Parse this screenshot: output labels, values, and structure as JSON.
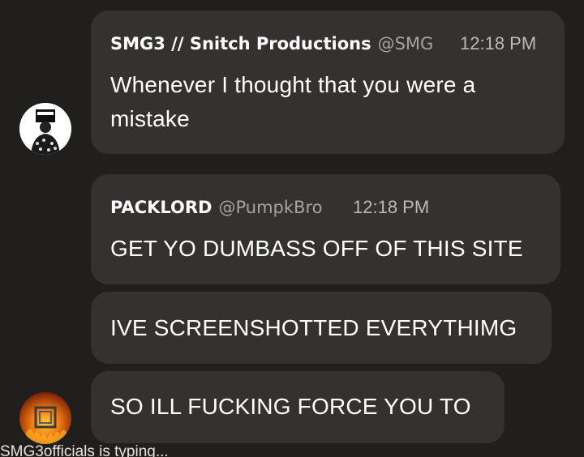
{
  "messages": [
    {
      "author": "SMG3 // Snitch Productions",
      "handle": "@SMG",
      "time": "12:18 PM",
      "lines": [
        "Whenever I thought that you were a",
        "mistake"
      ]
    },
    {
      "author": "PACKLORD",
      "handle": "@PumpkBro",
      "time": "12:18 PM",
      "lines": [
        "GET YO DUMBASS OFF OF THIS SITE"
      ]
    },
    {
      "lines": [
        "IVE SCREENSHOTTED EVERYTHIMG"
      ]
    },
    {
      "lines": [
        "SO ILL FUCKING FORCE YOU TO"
      ]
    }
  ],
  "typing_indicator": "SMG3officials is typing...",
  "colors": {
    "background": "#211f1e",
    "bubble": "#343130",
    "handle": "#a8a39f",
    "text": "#ffffff"
  },
  "icons": {
    "avatar_smg3": "avatar-smg3-icon",
    "avatar_packlord": "avatar-packlord-icon"
  }
}
